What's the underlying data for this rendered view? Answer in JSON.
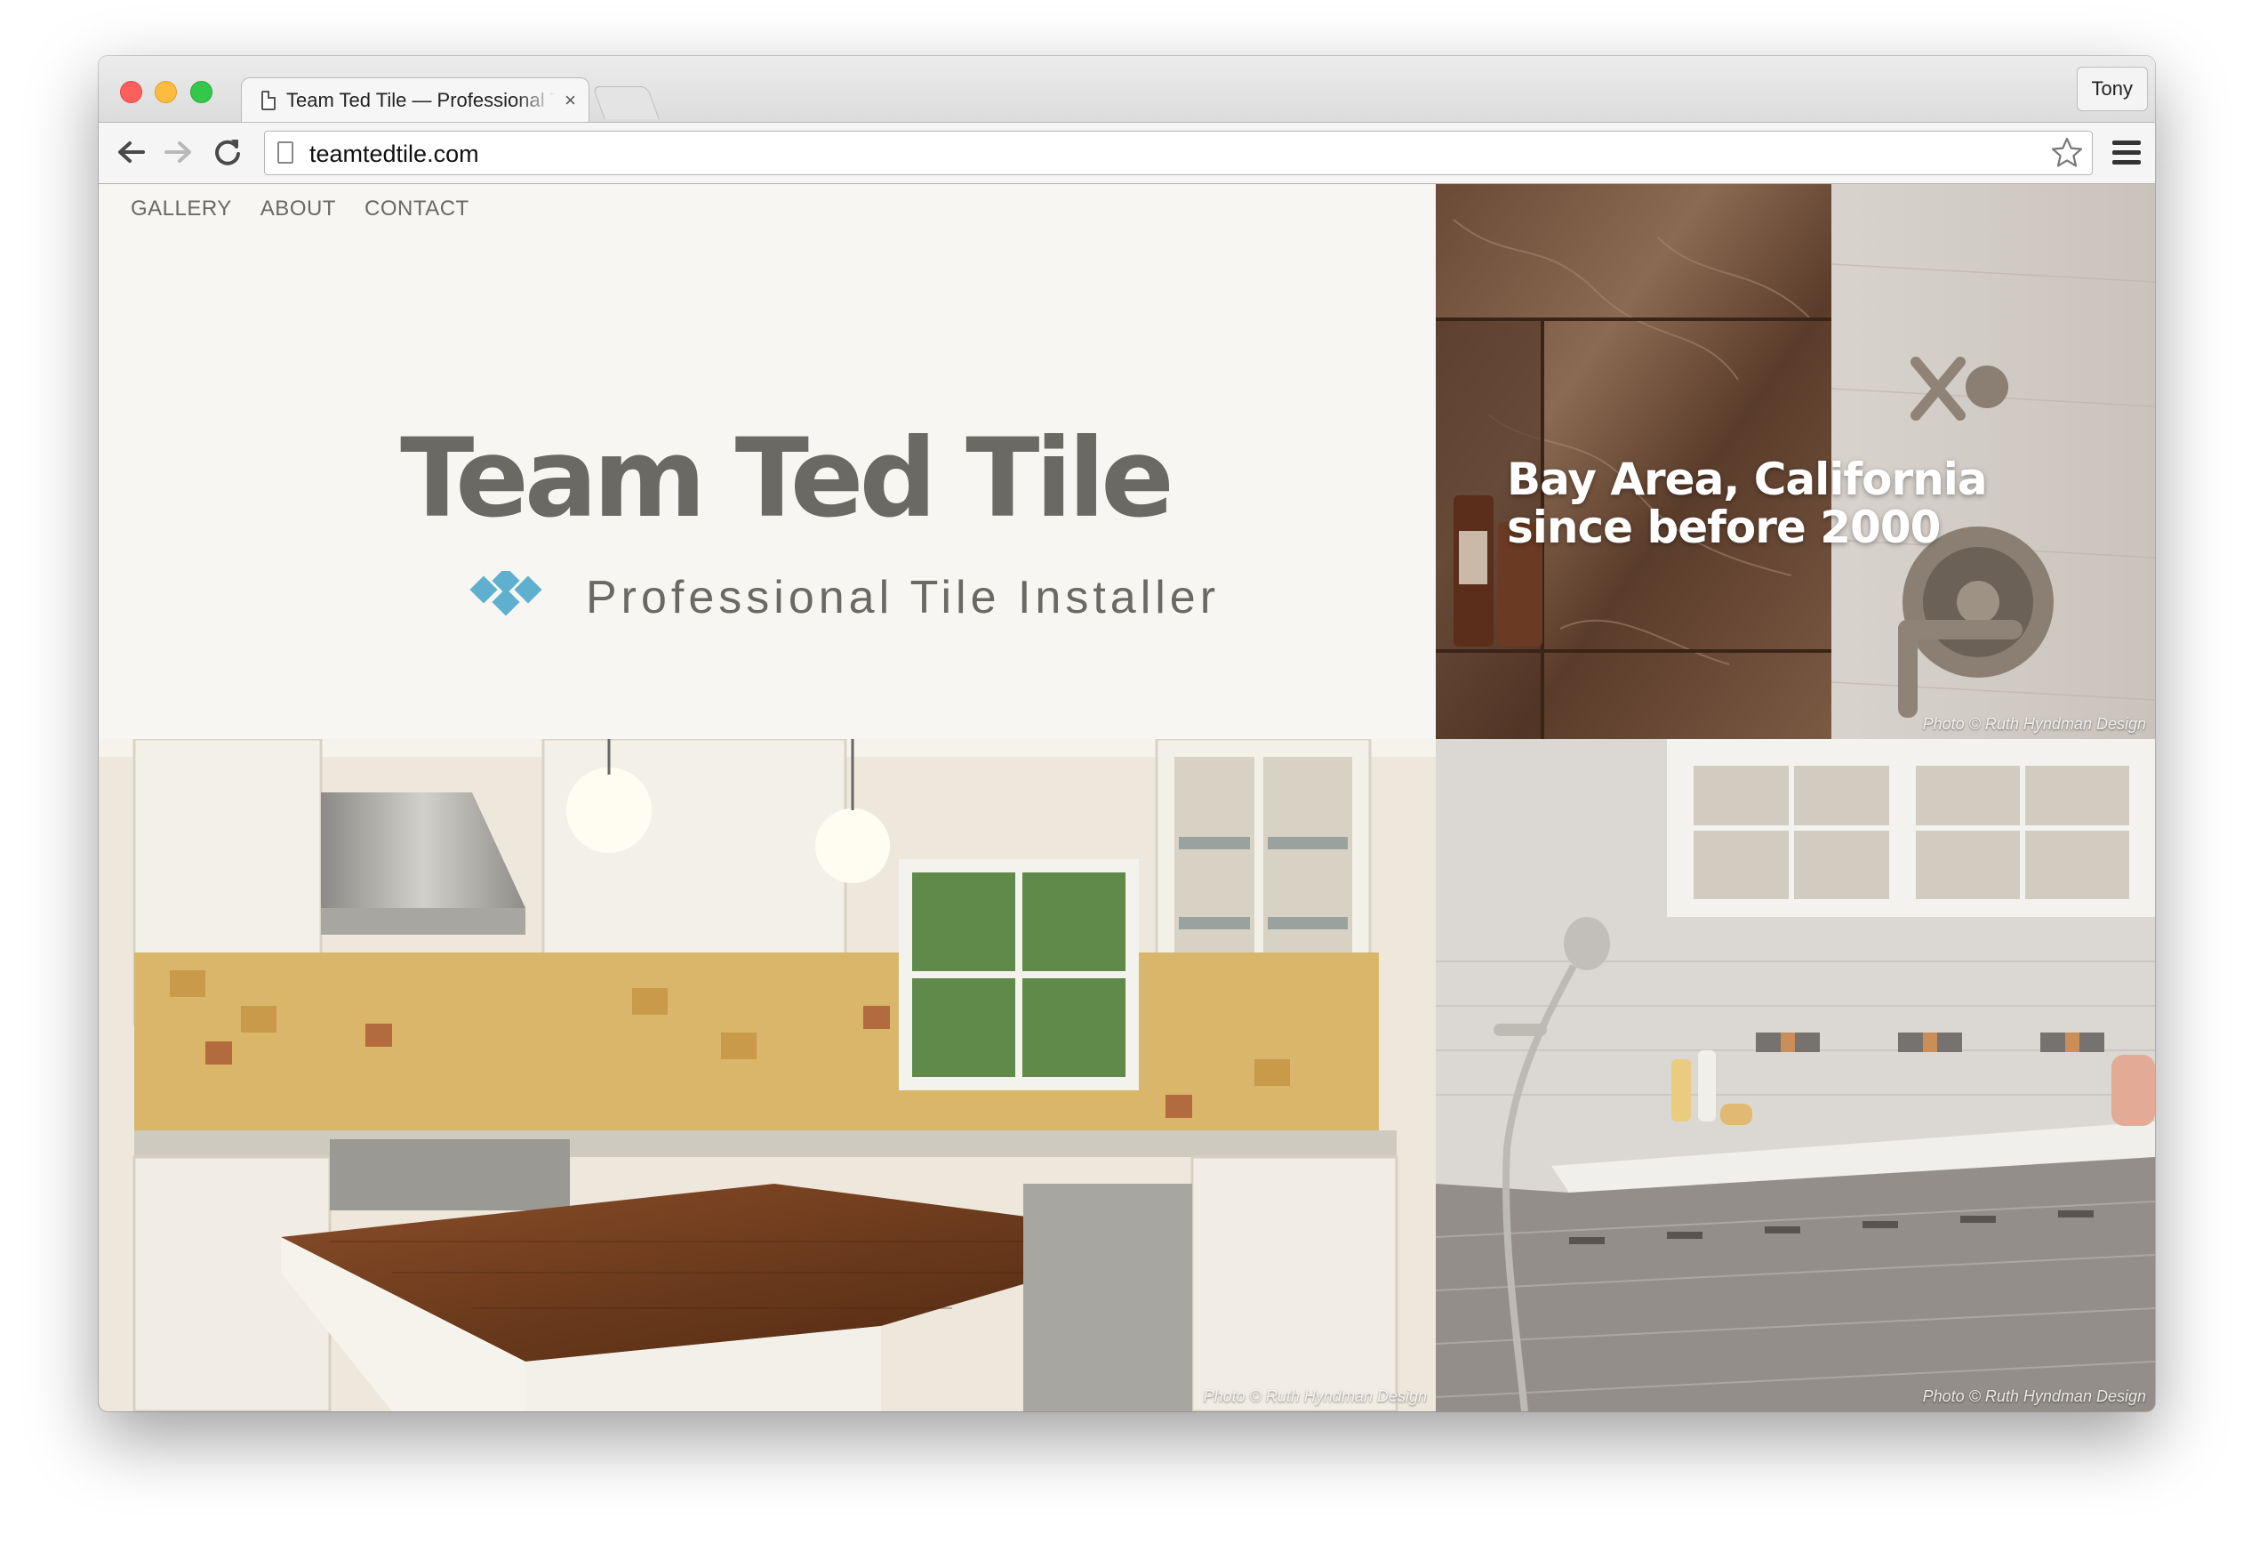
{
  "browser": {
    "tab_title": "Team Ted Tile — Professional Tile Installer",
    "tab_close": "×",
    "profile_name": "Tony",
    "url": "teamtedtile.com"
  },
  "site": {
    "nav": [
      "GALLERY",
      "ABOUT",
      "CONTACT"
    ],
    "title": "Team Ted Tile",
    "tagline": "Professional Tile Installer",
    "logo_color": "#5fb0cf",
    "hero_overlay": [
      "Bay Area, California",
      "since before 2000"
    ],
    "credits": {
      "shower_marble": "Photo © Ruth Hyndman Design",
      "kitchen": "Photo © Ruth Hyndman Design",
      "bathroom": "Photo © Ruth Hyndman Design"
    }
  }
}
